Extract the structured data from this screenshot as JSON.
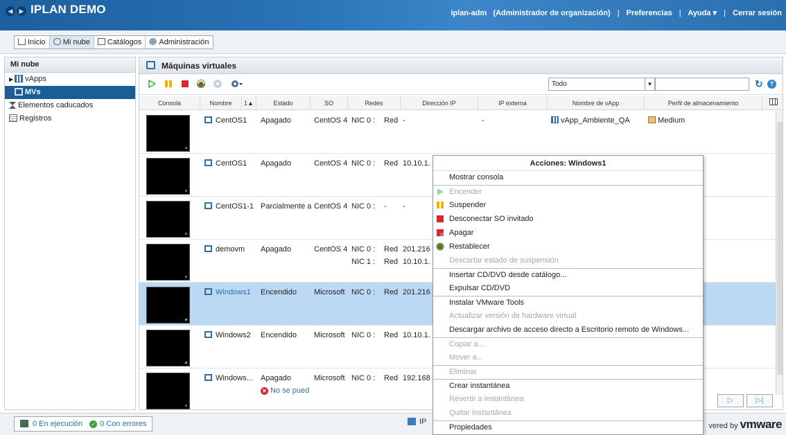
{
  "header": {
    "title": "IPLAN DEMO",
    "user": "iplan-adm",
    "role": "(Administrador de organización)",
    "preferences": "Preferencias",
    "help": "Ayuda ▾",
    "logout": "Cerrar sesión"
  },
  "tabs": [
    "Inicio",
    "Mi nube",
    "Catálogos",
    "Administración"
  ],
  "sidebar": {
    "title": "Mi nube",
    "items": [
      "vApps",
      "MVs",
      "Elementos caducados",
      "Registros"
    ]
  },
  "panel": {
    "title": "Máquinas virtuales",
    "filter": "Todo",
    "search_placeholder": ""
  },
  "table": {
    "headers": [
      "Consola",
      "Nombre",
      "1▲",
      "Estado",
      "SO",
      "Redes",
      "Dirección IP",
      "IP externa",
      "Nombre de vApp",
      "Perfil de almacenamiento"
    ],
    "rows": [
      {
        "name": "CentOS1",
        "state": "Apagado",
        "os": "CentOS 4",
        "nic": "NIC 0 :",
        "net": "Red",
        "ip": "-",
        "ext": "-",
        "vapp": "vApp_Ambiente_QA",
        "profile": "Medium",
        "sub": "",
        "nic2": "",
        "net2": "",
        "ip2": "",
        "power": "off"
      },
      {
        "name": "CentOS1",
        "state": "Apagado",
        "os": "CentOS 4",
        "nic": "NIC 0 :",
        "net": "Red",
        "ip": "10.10.1.",
        "ext": "",
        "vapp": "",
        "profile": "",
        "sub": "",
        "nic2": "",
        "net2": "",
        "ip2": "",
        "power": "off"
      },
      {
        "name": "CentOS1-1",
        "state": "Parcialmente a",
        "os": "CentOS 4",
        "nic": "NIC 0 :",
        "net": "-",
        "ip": "-",
        "ext": "",
        "vapp": "",
        "profile": "",
        "sub": "",
        "nic2": "",
        "net2": "",
        "ip2": "",
        "power": "off"
      },
      {
        "name": "demovm",
        "state": "Apagado",
        "os": "CentOS 4",
        "nic": "NIC 0 :",
        "net": "Red",
        "ip": "201.216",
        "ext": "",
        "vapp": "",
        "profile": "",
        "sub": "",
        "nic2": "NIC 1 :",
        "net2": "Red",
        "ip2": "10.10.1.",
        "power": "off"
      },
      {
        "name": "Windows1",
        "state": "Encendido",
        "os": "Microsoft",
        "nic": "NIC 0 :",
        "net": "Red",
        "ip": "201.216",
        "ext": "",
        "vapp": "",
        "profile": "",
        "sub": "",
        "nic2": "",
        "net2": "",
        "ip2": "",
        "power": "on"
      },
      {
        "name": "Windows2",
        "state": "Encendido",
        "os": "Microsoft",
        "nic": "NIC 0 :",
        "net": "Red",
        "ip": "10.10.1.",
        "ext": "",
        "vapp": "",
        "profile": "",
        "sub": "",
        "nic2": "",
        "net2": "",
        "ip2": "",
        "power": "on"
      },
      {
        "name": "Windows...",
        "state": "Apagado",
        "os": "Microsoft",
        "nic": "NIC 0 :",
        "net": "Red",
        "ip": "192.168",
        "ext": "",
        "vapp": "",
        "profile": "",
        "sub": "No se pued",
        "nic2": "",
        "net2": "",
        "ip2": "",
        "power": "off"
      }
    ]
  },
  "context_menu": {
    "title": "Acciones: Windows1",
    "items": [
      {
        "label": "Mostrar consola",
        "enabled": true,
        "icon": "",
        "sep": false
      },
      {
        "label": "Encender",
        "enabled": false,
        "icon": "play-icon",
        "sep": true
      },
      {
        "label": "Suspender",
        "enabled": true,
        "icon": "pause-icon",
        "sep": false
      },
      {
        "label": "Desconectar SO invitado",
        "enabled": true,
        "icon": "stop-icon",
        "sep": false
      },
      {
        "label": "Apagar",
        "enabled": true,
        "icon": "power-off-icon",
        "sep": false
      },
      {
        "label": "Restablecer",
        "enabled": true,
        "icon": "reset-icon",
        "sep": false
      },
      {
        "label": "Descartar estado de suspensión",
        "enabled": false,
        "icon": "",
        "sep": false
      },
      {
        "label": "Insertar CD/DVD desde catálogo...",
        "enabled": true,
        "icon": "",
        "sep": true
      },
      {
        "label": "Expulsar CD/DVD",
        "enabled": true,
        "icon": "",
        "sep": false
      },
      {
        "label": "Instalar VMware Tools",
        "enabled": true,
        "icon": "",
        "sep": true
      },
      {
        "label": "Actualizar versión de hardware virtual",
        "enabled": false,
        "icon": "",
        "sep": false
      },
      {
        "label": "Descargar archivo de acceso directo a Escritorio remoto de Windows...",
        "enabled": true,
        "icon": "",
        "sep": false
      },
      {
        "label": "Copiar a...",
        "enabled": false,
        "icon": "",
        "sep": true
      },
      {
        "label": "Mover a...",
        "enabled": false,
        "icon": "",
        "sep": false
      },
      {
        "label": "Eliminar",
        "enabled": false,
        "icon": "",
        "sep": true
      },
      {
        "label": "Crear instantánea",
        "enabled": true,
        "icon": "",
        "sep": true
      },
      {
        "label": "Revertir a instantánea",
        "enabled": false,
        "icon": "",
        "sep": false
      },
      {
        "label": "Quitar instantánea",
        "enabled": false,
        "icon": "",
        "sep": false
      },
      {
        "label": "Propiedades",
        "enabled": true,
        "icon": "",
        "sep": true
      }
    ]
  },
  "status": {
    "running": "0 En ejecución",
    "errors": "0 Con errores",
    "mid": "IP",
    "powered": "vered by",
    "brand": "vmware"
  },
  "colors": {
    "header": "#2a74b8",
    "selection": "#bcd9f3",
    "sidebar_selected": "#1b5d97"
  }
}
